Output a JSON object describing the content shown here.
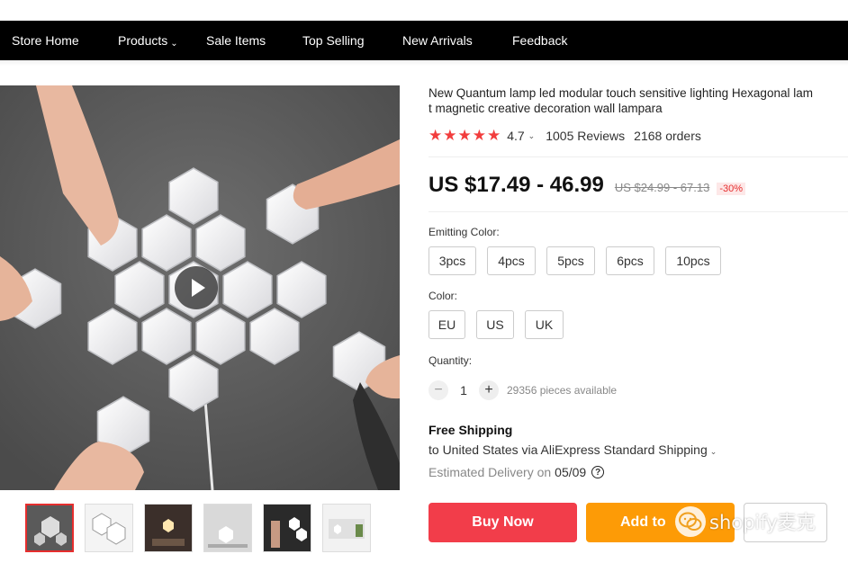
{
  "nav": {
    "items": [
      "Store Home",
      "Products",
      "Sale Items",
      "Top Selling",
      "New Arrivals",
      "Feedback"
    ]
  },
  "product": {
    "title_line1": "New Quantum lamp led modular touch sensitive lighting Hexagonal lam",
    "title_line2": "t magnetic creative decoration wall lampara",
    "rating": "4.7",
    "reviews": "1005 Reviews",
    "orders": "2168 orders",
    "price": "US $17.49 - 46.99",
    "old_price": "US $24.99 - 67.13",
    "discount": "-30%"
  },
  "options": {
    "emitting_label": "Emitting Color:",
    "emitting": [
      "3pcs",
      "4pcs",
      "5pcs",
      "6pcs",
      "10pcs"
    ],
    "color_label": "Color:",
    "color": [
      "EU",
      "US",
      "UK"
    ]
  },
  "quantity": {
    "label": "Quantity:",
    "value": "1",
    "available": "29356 pieces available"
  },
  "shipping": {
    "title": "Free Shipping",
    "line": "to United States via AliExpress Standard Shipping",
    "delivery_prefix": "Estimated Delivery on",
    "delivery_date": "05/09"
  },
  "actions": {
    "buy_now": "Buy Now",
    "add_to_cart": "Add to"
  },
  "watermark": {
    "text": "shopify麦克"
  },
  "colors": {
    "nav_bg": "#000000",
    "buy_now": "#f23d4a",
    "add_to_cart": "#fd9b06",
    "star": "#f23d3d",
    "discount": "#e62e2e"
  }
}
